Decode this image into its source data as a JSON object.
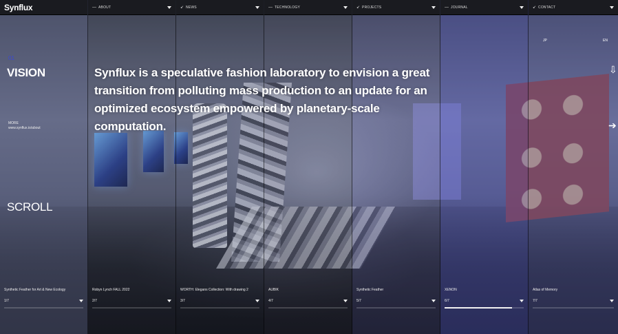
{
  "brand": {
    "logo": "Synflux"
  },
  "nav": [
    {
      "label": "ABOUT"
    },
    {
      "label": "NEWS"
    },
    {
      "label": "TECHNOLOGY"
    },
    {
      "label": "PROJECTS"
    },
    {
      "label": "JOURNAL"
    },
    {
      "label": "CONTACT"
    }
  ],
  "hero": {
    "index": "01",
    "section_title": "VISION",
    "headline": "Synflux is a speculative fashion laboratory to envision a great transition from polluting mass production to an update for an optimized ecosystem empowered by planetary-scale computation.",
    "more_label": "MORE",
    "more_link": "www.synflux.io/about",
    "scroll_label": "SCROLL"
  },
  "languages": {
    "jp": "JP",
    "en": "EN"
  },
  "icons": {
    "down": "down-arrow-icon",
    "right": "right-arrow-icon",
    "caret": "caret-down-icon"
  },
  "slides": [
    {
      "title": "Synthetic Feather for Art & New Ecology",
      "counter": "1/7",
      "progress": 0.0
    },
    {
      "title": "Robyn Lynch FALL 2022",
      "counter": "2/7",
      "progress": 0.0
    },
    {
      "title": "WORTH: Elegans Collection: With drawing 2",
      "counter": "3/7",
      "progress": 0.0
    },
    {
      "title": "AUBIK",
      "counter": "4/7",
      "progress": 0.0
    },
    {
      "title": "Synthetic Feather",
      "counter": "5/7",
      "progress": 0.0
    },
    {
      "title": "XENON",
      "counter": "6/7",
      "progress": 0.85
    },
    {
      "title": "Atlas of Memory",
      "counter": "7/7",
      "progress": 0.0
    }
  ],
  "colors": {
    "accent": "#3a48d8",
    "header_bg": "#1a1b20"
  }
}
